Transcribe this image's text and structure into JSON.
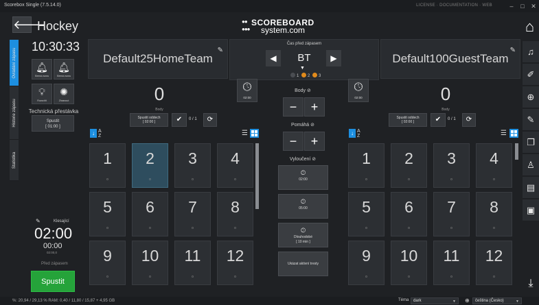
{
  "window": {
    "title": "Scorebox Single (7.5.14.0)",
    "links": "LICENSE  ·  DOCUMENTATION  ·  WEB",
    "controls": [
      "–",
      "□",
      "✕"
    ]
  },
  "header": {
    "back_icon": "arrow-left-icon",
    "sport": "Hockey",
    "logo_top": "SCOREBOARD",
    "logo_bottom": "system.com"
  },
  "left_tabs": [
    "Ovládání zápasu",
    "Historie zápasu",
    "Statistika"
  ],
  "left_panel": {
    "clock": "10:30:33",
    "buttons": [
      {
        "label": "Sirená zvonu",
        "icon": "bell-icon"
      },
      {
        "label": "Sirená zvonu",
        "icon": "bell-icon"
      },
      {
        "label": "Rozsvítit",
        "icon": "bulb-icon"
      },
      {
        "label": "Zhasnout",
        "icon": "bulb-off-icon"
      }
    ],
    "technical_break": "Technická přestávka",
    "start_tech": "Spustit",
    "start_tech_time": "[ 01:00 ]",
    "countdown_label": "Klesající",
    "main_time": "02:00",
    "sub_time": "00:00",
    "sub_time_small": "02:00,0",
    "before_match": "Před zápasem",
    "start_button": "Spustit"
  },
  "home": {
    "name": "Default25HomeTeam",
    "score": "0",
    "score_label": "Body",
    "timer_label": "02:00",
    "timeout_label": "Spustit oddech",
    "timeout_time": "[ 02:00 ]",
    "timeout_count": "0 / 1",
    "sort_alpha_top": "A",
    "sort_alpha_bottom": "Z",
    "players": [
      {
        "n": "1",
        "s": "0"
      },
      {
        "n": "2",
        "s": "0"
      },
      {
        "n": "3",
        "s": "0"
      },
      {
        "n": "4",
        "s": "0"
      },
      {
        "n": "5",
        "s": "0"
      },
      {
        "n": "6",
        "s": "0"
      },
      {
        "n": "7",
        "s": "0"
      },
      {
        "n": "8",
        "s": "0"
      },
      {
        "n": "9",
        "s": "0"
      },
      {
        "n": "10",
        "s": "0"
      },
      {
        "n": "11",
        "s": "0"
      },
      {
        "n": "12",
        "s": "0"
      }
    ],
    "selected_player": "2"
  },
  "guest": {
    "name": "Default100GuestTeam",
    "score": "0",
    "score_label": "Body",
    "timer_label": "02:00",
    "timeout_label": "Spustit oddech",
    "timeout_time": "[ 02:00 ]",
    "timeout_count": "0 / 1",
    "sort_alpha_top": "A",
    "sort_alpha_bottom": "Z",
    "players": [
      {
        "n": "1",
        "s": "0"
      },
      {
        "n": "2",
        "s": "0"
      },
      {
        "n": "3",
        "s": "0"
      },
      {
        "n": "4",
        "s": "0"
      },
      {
        "n": "5",
        "s": "0"
      },
      {
        "n": "6",
        "s": "0"
      },
      {
        "n": "7",
        "s": "0"
      },
      {
        "n": "8",
        "s": "0"
      },
      {
        "n": "9",
        "s": "0"
      },
      {
        "n": "10",
        "s": "0"
      },
      {
        "n": "11",
        "s": "0"
      },
      {
        "n": "12",
        "s": "0"
      }
    ]
  },
  "center": {
    "period_label": "Čas před zápasem",
    "period": "BT",
    "period_dots": [
      "1",
      "2",
      "3"
    ],
    "period_colors": [
      "#4a4d52",
      "#e08a1c",
      "#e08a1c"
    ],
    "points_label": "Body",
    "assist_label": "Pomáhá",
    "penalties_label": "Vyloučení",
    "minus": "−",
    "plus": "+",
    "penalty_buttons": [
      {
        "time": "02:00"
      },
      {
        "time": "05:00"
      },
      {
        "label": "Dlouhodobé",
        "time": "[ 10 min ]"
      }
    ],
    "show_penalties": "Ukázat aktivní tresty"
  },
  "right_toolbar": [
    "home-icon",
    "music-icon",
    "pen-icon",
    "globe-icon",
    "edit-icon",
    "copy-icon",
    "shirt-icon",
    "scoreboard-icon",
    "video-icon",
    "download-icon"
  ],
  "status": {
    "stats": "%: 20,94 / 29,13 % RAM: 0,40 / 11,80 / 15,87 + 4,95 GB",
    "theme_label": "Téma",
    "theme_value": "dark",
    "language_value": "čeština (Česko)"
  },
  "colors": {
    "accent": "#1d8fe0",
    "start": "#25a33a",
    "selected_player": "#2e4d5e"
  }
}
